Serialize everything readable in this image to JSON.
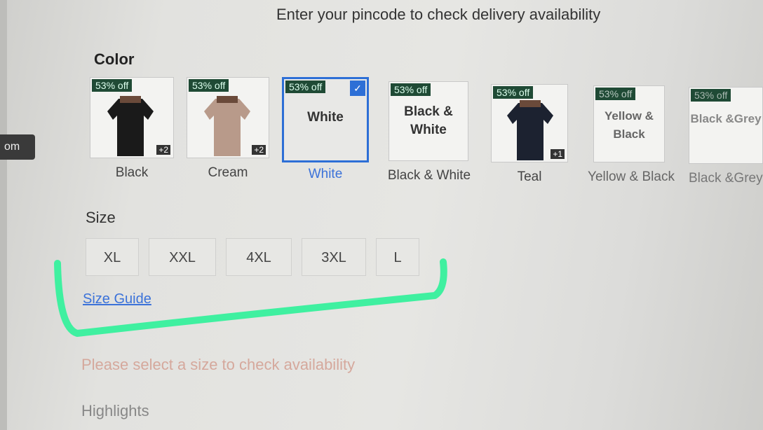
{
  "side_tab": "om",
  "pincode_prompt": "Enter your pincode to check delivery availability",
  "color": {
    "heading": "Color",
    "swatches": [
      {
        "name": "Black",
        "badge": "53% off",
        "extra": "+2",
        "shirt_color": "#1a1a1a"
      },
      {
        "name": "Cream",
        "badge": "53% off",
        "extra": "+2",
        "shirt_color": "#b89a8a"
      },
      {
        "name": "White",
        "badge": "53% off",
        "box_text": "White",
        "selected": true
      },
      {
        "name": "Black & White",
        "badge": "53% off",
        "box_text": "Black & White"
      },
      {
        "name": "Teal",
        "badge": "53% off",
        "extra": "+1",
        "shirt_color": "#1c2230"
      },
      {
        "name": "Yellow & Black",
        "badge": "53% off",
        "box_text": "Yellow & Black"
      },
      {
        "name": "Black &Grey",
        "badge": "53% off",
        "box_text": "Black &Grey"
      }
    ]
  },
  "size": {
    "heading": "Size",
    "options": [
      "XL",
      "XXL",
      "4XL",
      "3XL",
      "L"
    ],
    "guide_link": "Size Guide"
  },
  "availability_message": "Please select a size to check availability",
  "highlights_heading": "Highlights",
  "colors": {
    "accent": "#2d6fd6",
    "badge": "#1f4a35",
    "marker": "#3ff0a0"
  }
}
